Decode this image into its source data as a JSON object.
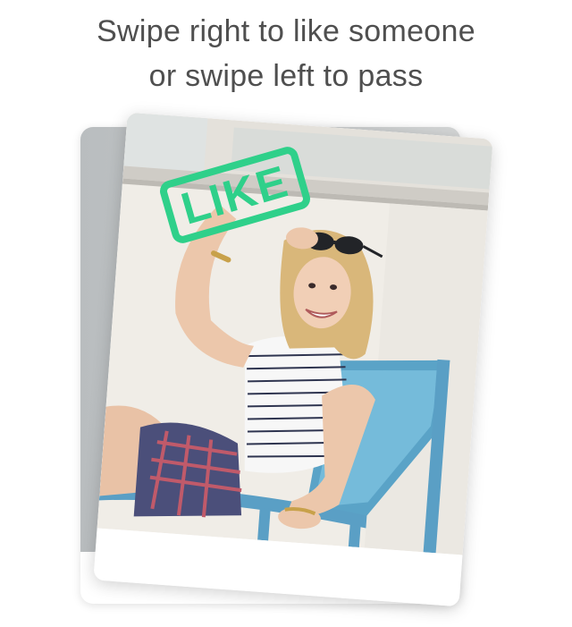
{
  "instruction": {
    "line1": "Swipe right to like someone",
    "line2": "or swipe left to pass"
  },
  "stamp": {
    "label": "LIKE",
    "color": "#2fd08a"
  }
}
